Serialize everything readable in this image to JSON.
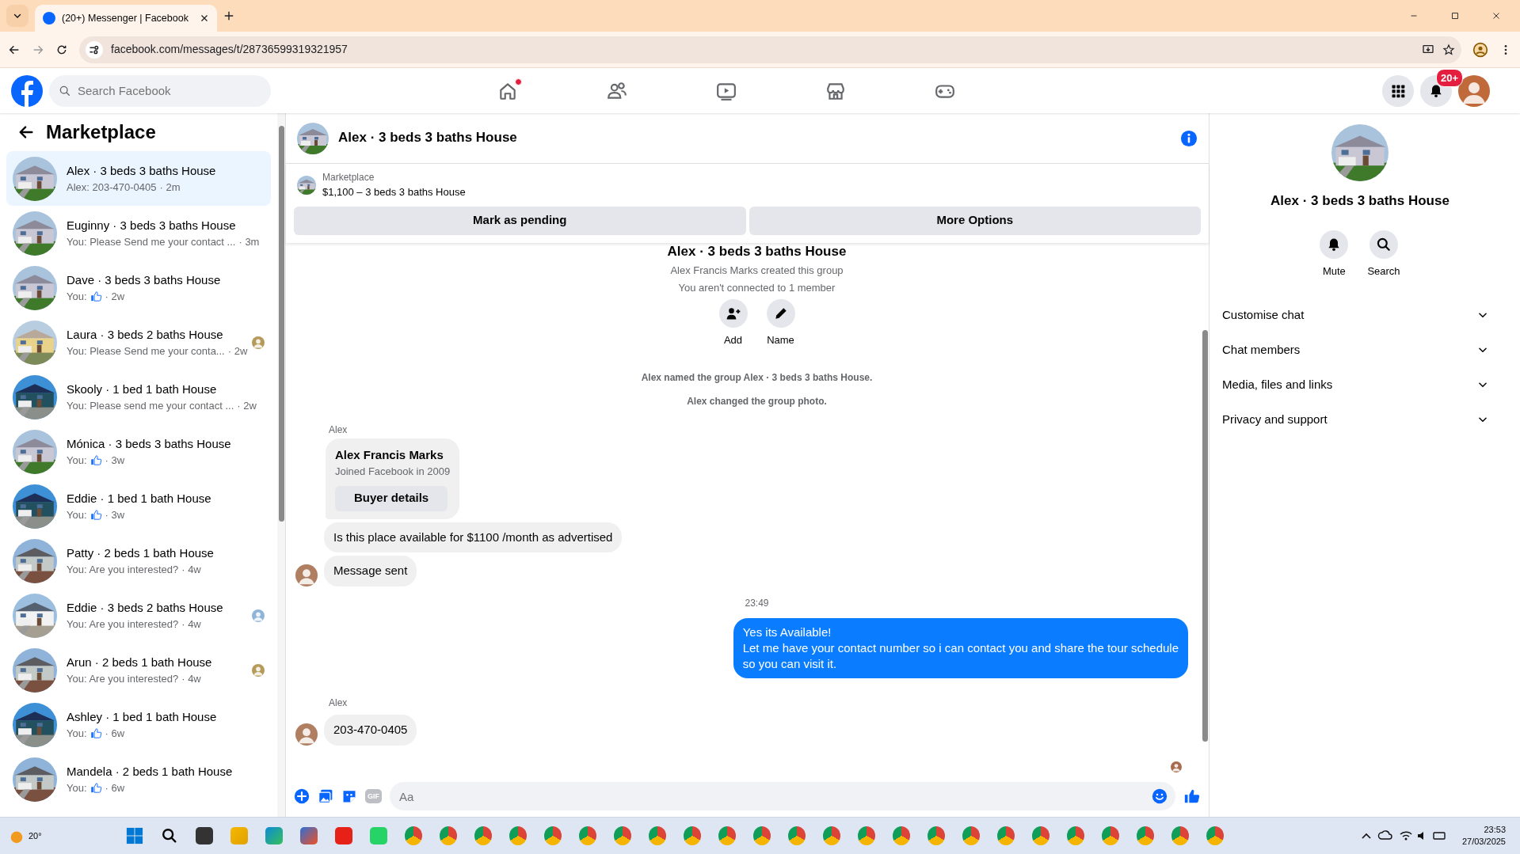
{
  "browser": {
    "tab_title": "(20+) Messenger | Facebook",
    "url": "facebook.com/messages/t/28736599319321957"
  },
  "topbar": {
    "search": {
      "placeholder": "Search Facebook"
    },
    "nav": [
      {
        "kind": "home",
        "dot": true
      },
      {
        "kind": "friends",
        "dot": false
      },
      {
        "kind": "video",
        "dot": false
      },
      {
        "kind": "marketplace",
        "dot": false
      },
      {
        "kind": "gaming",
        "dot": false
      }
    ],
    "notification_badge": "20+"
  },
  "sidebar": {
    "title": "Marketplace",
    "conversations": [
      {
        "title": "Alex · 3 beds 3 baths House",
        "preview": "Alex: 203-470-0405",
        "kind": "text",
        "time": "· 2m",
        "selected": true,
        "seen": false
      },
      {
        "title": "Euginny · 3 beds 3 baths House",
        "preview": "You: Please Send me your contact ...",
        "kind": "text",
        "time": "· 3m",
        "selected": false,
        "seen": false
      },
      {
        "title": "Dave · 3 beds 3 baths House",
        "preview": "You:",
        "kind": "like",
        "time": "· 2w",
        "selected": false,
        "seen": false
      },
      {
        "title": "Laura · 3 beds 2 baths House",
        "preview": "You: Please Send me your conta...",
        "kind": "text",
        "time": "· 2w",
        "selected": false,
        "seen": true
      },
      {
        "title": "Skooly · 1 bed 1 bath House",
        "preview": "You: Please send me your contact ...",
        "kind": "text",
        "time": "· 2w",
        "selected": false,
        "seen": false
      },
      {
        "title": "Mónica · 3 beds 3 baths House",
        "preview": "You:",
        "kind": "like",
        "time": "· 3w",
        "selected": false,
        "seen": false
      },
      {
        "title": "Eddie · 1 bed 1 bath House",
        "preview": "You:",
        "kind": "like",
        "time": "· 3w",
        "selected": false,
        "seen": false
      },
      {
        "title": "Patty · 2 beds 1 bath House",
        "preview": "You: Are you interested?",
        "kind": "text",
        "time": "· 4w",
        "selected": false,
        "seen": false
      },
      {
        "title": "Eddie · 3 beds 2 baths House",
        "preview": "You: Are you interested?",
        "kind": "text",
        "time": "· 4w",
        "selected": false,
        "seen": true
      },
      {
        "title": "Arun · 2 beds 1 bath House",
        "preview": "You: Are you interested?",
        "kind": "text",
        "time": "· 4w",
        "selected": false,
        "seen": true
      },
      {
        "title": "Ashley · 1 bed 1 bath House",
        "preview": "You:",
        "kind": "like",
        "time": "· 6w",
        "selected": false,
        "seen": false
      },
      {
        "title": "Mandela · 2 beds 1 bath House",
        "preview": "You:",
        "kind": "like",
        "time": "· 6w",
        "selected": false,
        "seen": false
      }
    ]
  },
  "chat": {
    "title": "Alex · 3 beds 3 baths House",
    "listing": {
      "label": "Marketplace",
      "text": "$1,100 – 3 beds 3 baths House"
    },
    "actions": [
      "Mark as pending",
      "More Options"
    ],
    "intro": {
      "title": "Alex · 3 beds 3 baths House",
      "lines": [
        "Alex Francis Marks created this group",
        "You aren't connected to 1 member"
      ],
      "buttons": [
        {
          "kind": "add",
          "label": "Add"
        },
        {
          "kind": "name",
          "label": "Name"
        }
      ]
    },
    "messages": [
      {
        "kind": "note",
        "text": "Alex named the group Alex · 3 beds 3 baths House."
      },
      {
        "kind": "note",
        "text": "Alex changed the group photo."
      },
      {
        "kind": "sender",
        "text": "Alex"
      },
      {
        "kind": "profile",
        "name": "Alex Francis Marks",
        "detail": "Joined Facebook in 2009",
        "button": "Buyer details"
      },
      {
        "kind": "incoming",
        "text": "Is this place available for $1100 /month as advertised",
        "avatar": false
      },
      {
        "kind": "incoming",
        "text": "Message sent",
        "avatar": true
      },
      {
        "kind": "time",
        "text": "23:49"
      },
      {
        "kind": "outgoing",
        "text": "Yes its Available!\nLet me have your contact number so i can contact you and share the tour schedule\nso you can visit it."
      },
      {
        "kind": "sender",
        "text": "Alex"
      },
      {
        "kind": "incoming",
        "text": "203-470-0405",
        "avatar": true
      }
    ],
    "composer": {
      "placeholder": "Aa",
      "gif": "GIF"
    }
  },
  "info": {
    "title": "Alex · 3 beds 3 baths House",
    "actions": [
      {
        "kind": "mute",
        "label": "Mute"
      },
      {
        "kind": "search",
        "label": "Search"
      }
    ],
    "sections": [
      {
        "label": "Customise chat",
        "expanded": false
      },
      {
        "label": "Chat members",
        "expanded": false
      },
      {
        "label": "Media, files and links",
        "expanded": false
      },
      {
        "label": "Privacy and support",
        "expanded": false
      }
    ]
  },
  "taskbar": {
    "weather": "20°",
    "time": "23:53",
    "date": "27/03/2025"
  }
}
